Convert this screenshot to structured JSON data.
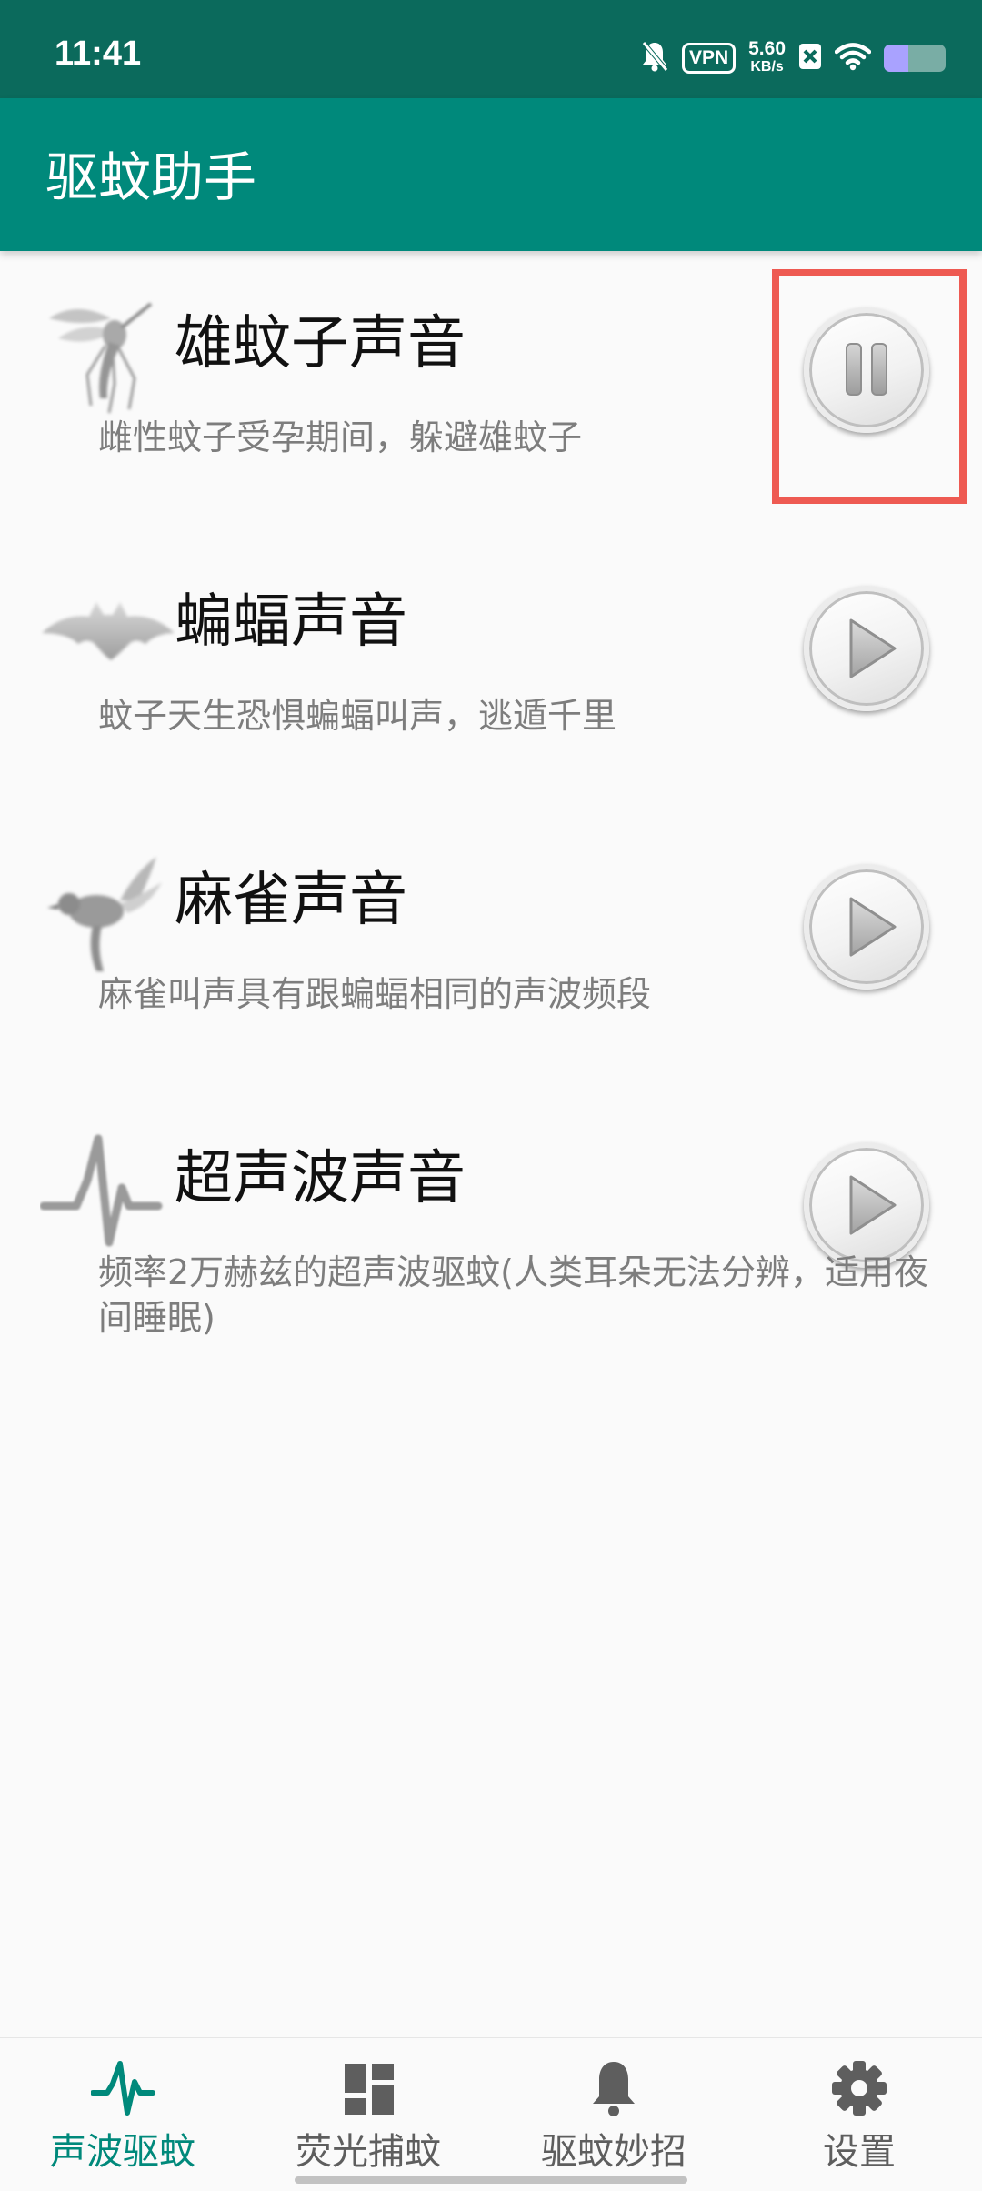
{
  "status_bar": {
    "time": "11:41",
    "vpn": "VPN",
    "net_speed_value": "5.60",
    "net_speed_unit": "KB/s",
    "battery_level": 0.4,
    "icons": [
      "bell-off-icon",
      "vpn-icon",
      "close-box-icon",
      "wifi-icon",
      "battery-icon"
    ]
  },
  "app_bar": {
    "title": "驱蚊助手"
  },
  "sounds": [
    {
      "title": "雄蚊子声音",
      "description": "雌性蚊子受孕期间，躲避雄蚊子",
      "icon": "mosquito-icon",
      "state": "playing"
    },
    {
      "title": "蝙蝠声音",
      "description": "蚊子天生恐惧蝙蝠叫声，逃遁千里",
      "icon": "bat-icon",
      "state": "stopped"
    },
    {
      "title": "麻雀声音",
      "description": "麻雀叫声具有跟蝙蝠相同的声波频段",
      "icon": "sparrow-icon",
      "state": "stopped"
    },
    {
      "title": "超声波声音",
      "description": "频率2万赫兹的超声波驱蚊(人类耳朵无法分辨，适用夜间睡眠)",
      "icon": "waveform-icon",
      "state": "stopped"
    }
  ],
  "bottom_nav": {
    "active": 0,
    "tabs": [
      {
        "label": "声波驱蚊",
        "icon": "pulse-icon"
      },
      {
        "label": "荧光捕蚊",
        "icon": "dashboard-icon"
      },
      {
        "label": "驱蚊妙招",
        "icon": "bell-icon"
      },
      {
        "label": "设置",
        "icon": "gear-icon"
      }
    ]
  },
  "colors": {
    "status_bar": "#0b6a5c",
    "app_bar": "#00897b",
    "accent": "#00897b",
    "highlight": "#ee5a52",
    "inactive_nav": "#5e5e5e"
  }
}
